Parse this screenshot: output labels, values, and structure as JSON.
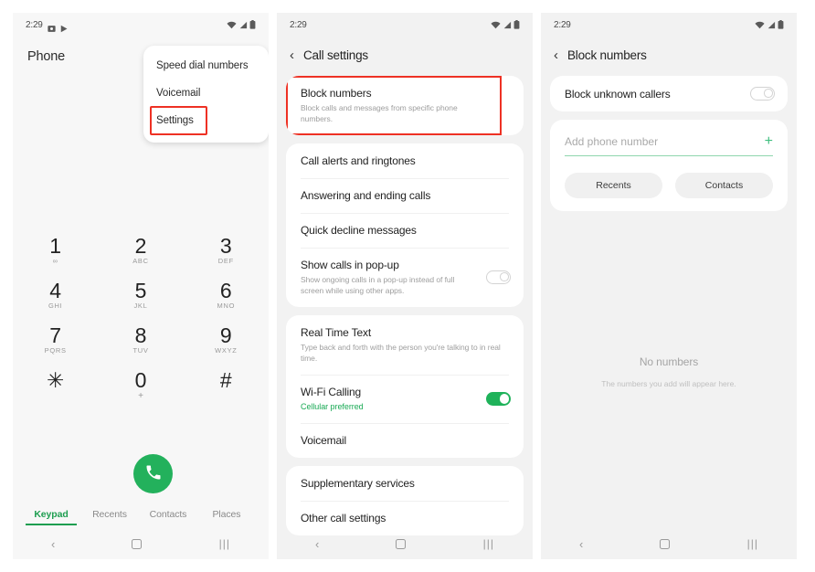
{
  "statusbar": {
    "time": "2:29",
    "left_icons": [
      "screenshot-icon",
      "play-icon"
    ],
    "right_icons": [
      "wifi-icon",
      "signal-icon",
      "battery-icon"
    ]
  },
  "navbar": {
    "back_label": "‹",
    "home_label": "home-square",
    "recents_label": "|||"
  },
  "colors": {
    "accent_green": "#1fb25a",
    "highlight_red": "#ee3124",
    "panel_bg": "#f2f2f2",
    "card_bg": "#ffffff",
    "muted_text": "#9e9e9e"
  },
  "panel1": {
    "app_title": "Phone",
    "popup_menu": {
      "items": [
        {
          "label": "Speed dial numbers",
          "highlighted": false
        },
        {
          "label": "Voicemail",
          "highlighted": false
        },
        {
          "label": "Settings",
          "highlighted": true
        }
      ]
    },
    "keypad": [
      {
        "digit": "1",
        "sub": "∞"
      },
      {
        "digit": "2",
        "sub": "ABC"
      },
      {
        "digit": "3",
        "sub": "DEF"
      },
      {
        "digit": "4",
        "sub": "GHI"
      },
      {
        "digit": "5",
        "sub": "JKL"
      },
      {
        "digit": "6",
        "sub": "MNO"
      },
      {
        "digit": "7",
        "sub": "PQRS"
      },
      {
        "digit": "8",
        "sub": "TUV"
      },
      {
        "digit": "9",
        "sub": "WXYZ"
      },
      {
        "digit": "✳",
        "sub": ""
      },
      {
        "digit": "0",
        "sub": "+"
      },
      {
        "digit": "#",
        "sub": ""
      }
    ],
    "call_button": "call-icon",
    "tabs": [
      {
        "label": "Keypad",
        "active": true
      },
      {
        "label": "Recents",
        "active": false
      },
      {
        "label": "Contacts",
        "active": false
      },
      {
        "label": "Places",
        "active": false
      }
    ]
  },
  "panel2": {
    "title": "Call settings",
    "groups": [
      {
        "rows": [
          {
            "title": "Block numbers",
            "sub": "Block calls and messages from specific phone numbers.",
            "highlighted": true,
            "toggle": null
          }
        ]
      },
      {
        "rows": [
          {
            "title": "Call alerts and ringtones",
            "sub": "",
            "highlighted": false,
            "toggle": null
          },
          {
            "title": "Answering and ending calls",
            "sub": "",
            "highlighted": false,
            "toggle": null
          },
          {
            "title": "Quick decline messages",
            "sub": "",
            "highlighted": false,
            "toggle": null
          },
          {
            "title": "Show calls in pop-up",
            "sub": "Show ongoing calls in a pop-up instead of full screen while using other apps.",
            "highlighted": false,
            "toggle": "off"
          }
        ]
      },
      {
        "rows": [
          {
            "title": "Real Time Text",
            "sub": "Type back and forth with the person you're talking to in real time.",
            "highlighted": false,
            "toggle": null
          },
          {
            "title": "Wi-Fi Calling",
            "sub": "Cellular preferred",
            "sub_style": "green",
            "highlighted": false,
            "toggle": "on"
          },
          {
            "title": "Voicemail",
            "sub": "",
            "highlighted": false,
            "toggle": null
          }
        ]
      },
      {
        "rows": [
          {
            "title": "Supplementary services",
            "sub": "",
            "highlighted": false,
            "toggle": null
          },
          {
            "title": "Other call settings",
            "sub": "",
            "highlighted": false,
            "toggle": null
          }
        ]
      }
    ]
  },
  "panel3": {
    "title": "Block numbers",
    "block_unknown": {
      "label": "Block unknown callers",
      "toggle": "off"
    },
    "add_number": {
      "placeholder": "Add phone number",
      "value": "",
      "add_icon": "plus-icon"
    },
    "pills": [
      {
        "label": "Recents"
      },
      {
        "label": "Contacts"
      }
    ],
    "empty_state": {
      "title": "No numbers",
      "subtitle": "The numbers you add will appear here."
    }
  }
}
